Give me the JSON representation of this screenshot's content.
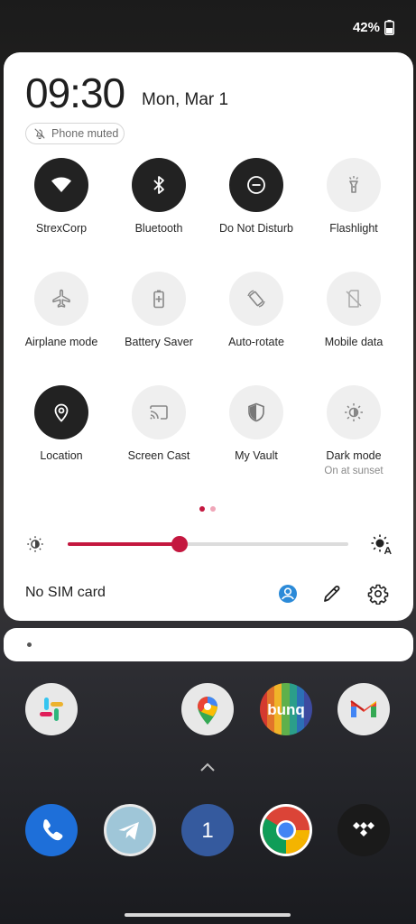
{
  "status": {
    "battery": "42%"
  },
  "header": {
    "time": "09:30",
    "date": "Mon, Mar 1",
    "chip": "Phone muted"
  },
  "tiles": [
    {
      "label": "StrexCorp",
      "icon": "wifi-icon",
      "state": "on"
    },
    {
      "label": "Bluetooth",
      "icon": "bluetooth-icon",
      "state": "on"
    },
    {
      "label": "Do Not Disturb",
      "icon": "do-not-disturb-icon",
      "state": "on"
    },
    {
      "label": "Flashlight",
      "icon": "flashlight-icon",
      "state": "off"
    },
    {
      "label": "Airplane mode",
      "icon": "airplane-icon",
      "state": "off"
    },
    {
      "label": "Battery Saver",
      "icon": "battery-saver-icon",
      "state": "off"
    },
    {
      "label": "Auto-rotate",
      "icon": "auto-rotate-icon",
      "state": "off"
    },
    {
      "label": "Mobile data",
      "icon": "mobile-data-icon",
      "state": "off"
    },
    {
      "label": "Location",
      "icon": "location-icon",
      "state": "on"
    },
    {
      "label": "Screen Cast",
      "icon": "screen-cast-icon",
      "state": "off"
    },
    {
      "label": "My Vault",
      "icon": "vault-shield-icon",
      "state": "off"
    },
    {
      "label": "Dark mode",
      "sublabel": "On at sunset",
      "icon": "dark-mode-icon",
      "state": "off"
    }
  ],
  "pagination": {
    "current": 1,
    "total": 2
  },
  "brightness": {
    "level": 0.4
  },
  "footer": {
    "sim": "No SIM card"
  },
  "apps": {
    "row1": [
      "Slack",
      "Google Maps",
      "bunq",
      "Gmail"
    ],
    "dock": [
      "Phone",
      "Telegram",
      "1",
      "Chrome",
      "Tidal"
    ],
    "bunq_label": "bunq",
    "one_label": "1"
  },
  "colors": {
    "accent": "#c4173f",
    "tile_on": "#222222",
    "tile_off": "#efefef",
    "account": "#2b8ad8"
  }
}
